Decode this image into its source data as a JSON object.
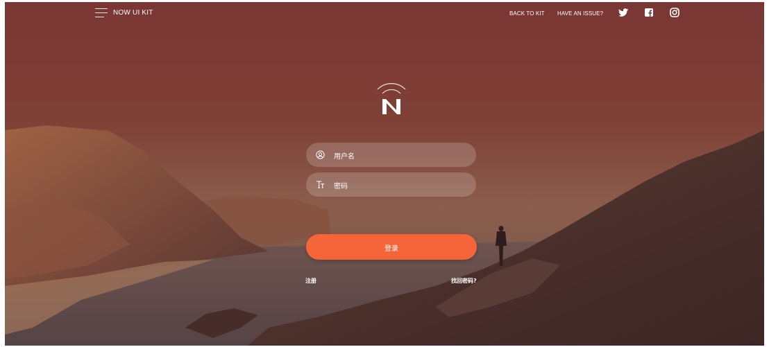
{
  "navbar": {
    "brand": "NOW UI KIT",
    "links": [
      "BACK TO KIT",
      "HAVE AN ISSUE?"
    ],
    "social_icons": [
      "twitter-icon",
      "facebook-icon",
      "instagram-icon"
    ]
  },
  "login": {
    "username_placeholder": "用户名",
    "password_placeholder": "密码",
    "submit_label": "登录",
    "register_link": "注册",
    "forgot_link": "找回密码?"
  },
  "colors": {
    "accent": "#f6643a",
    "overlay": "#7a3d38",
    "text": "#ffffff"
  }
}
